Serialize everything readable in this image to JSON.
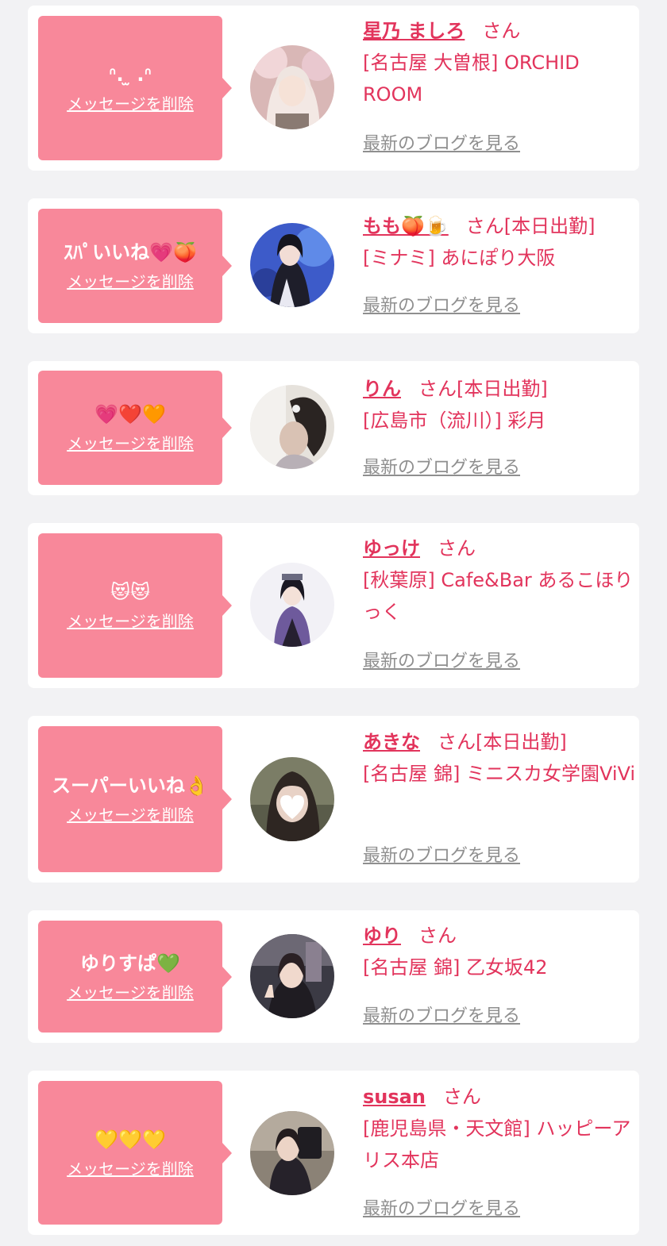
{
  "favorites": [
    {
      "message": "ᐢ. ̫ .ᐢ",
      "delete_label": "メッセージを削除",
      "name": "星乃 ましろ",
      "honorific": "さん",
      "status": "",
      "shop": "[名古屋 大曽根] ORCHID ROOM",
      "blog_label": "最新のブログを見る"
    },
    {
      "message": "ｽﾊﾟいいね💗🍑",
      "delete_label": "メッセージを削除",
      "name": "もも🍑🍺",
      "honorific": "さん",
      "status": "[本日出勤]",
      "shop": "[ミナミ] あにぽり大阪",
      "blog_label": "最新のブログを見る"
    },
    {
      "message": "💗❤️🧡",
      "delete_label": "メッセージを削除",
      "name": "りん",
      "honorific": "さん",
      "status": "[本日出勤]",
      "shop": "[広島市（流川）] 彩月",
      "blog_label": "最新のブログを見る"
    },
    {
      "message": "😻😻",
      "delete_label": "メッセージを削除",
      "name": "ゆっけ",
      "honorific": "さん",
      "status": "",
      "shop": "[秋葉原] Cafe&Bar あるこほりっく",
      "blog_label": "最新のブログを見る"
    },
    {
      "message": "スーパーいいね👌",
      "delete_label": "メッセージを削除",
      "name": "あきな",
      "honorific": "さん",
      "status": "[本日出勤]",
      "shop": "[名古屋 錦] ミニスカ女学園ViVi",
      "blog_label": "最新のブログを見る"
    },
    {
      "message": "ゆりすぱ💚",
      "delete_label": "メッセージを削除",
      "name": "ゆり",
      "honorific": "さん",
      "status": "",
      "shop": "[名古屋 錦] 乙女坂42",
      "blog_label": "最新のブログを見る"
    },
    {
      "message": "💛💛💛",
      "delete_label": "メッセージを削除",
      "name": "susan",
      "honorific": "さん",
      "status": "",
      "shop": "[鹿児島県・天文館] ハッピーアリス本店",
      "blog_label": "最新のブログを見る"
    }
  ],
  "colors": {
    "background": "#f2f2f4",
    "card": "#ffffff",
    "message_bubble": "#f8889a",
    "accent_text": "#e2345c",
    "link_gray": "#8f8f8f"
  }
}
